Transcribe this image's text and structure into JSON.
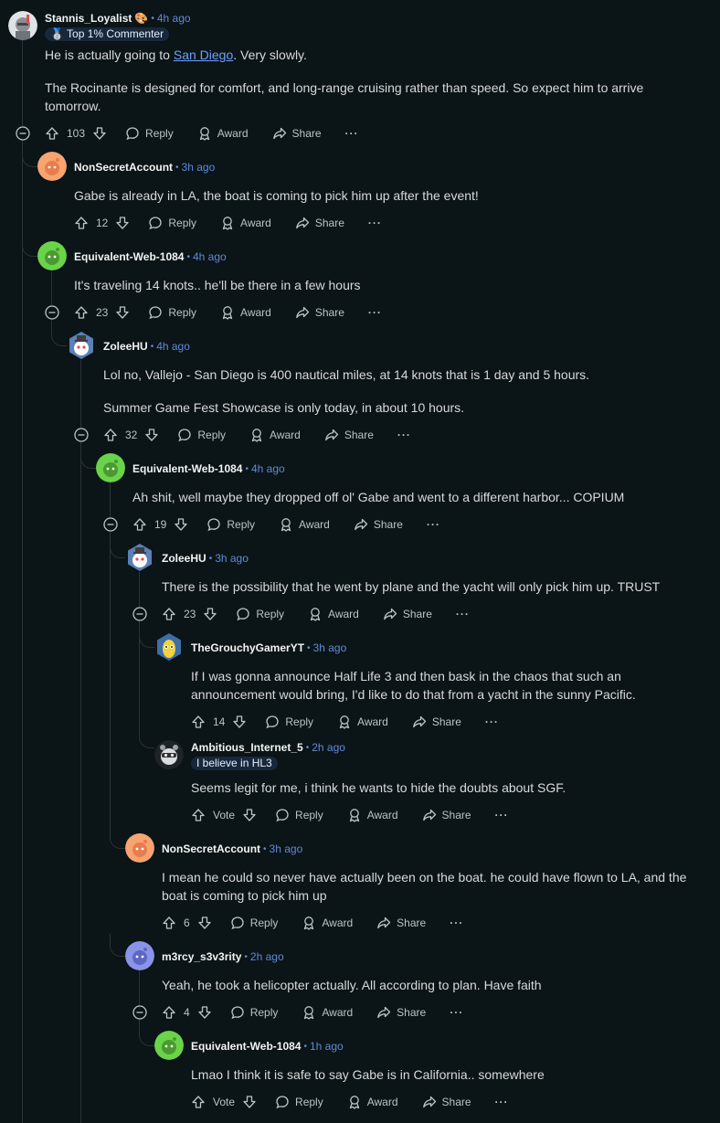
{
  "labels": {
    "reply": "Reply",
    "award": "Award",
    "share": "Share",
    "vote": "Vote",
    "more": "···"
  },
  "colors": {
    "background": "#0b1416",
    "username": "#f2f4f5",
    "time": "#5d8bd9",
    "link": "#6ea1ff",
    "thread_line": "#2a3236"
  },
  "comments": [
    {
      "user": "Stannis_Loyalist",
      "emoji": "🎨",
      "time": "4h ago",
      "flair": "🥈 Top 1% Commenter",
      "avatar": "avatar-knight",
      "body": [
        "He is actually going to ",
        "San Diego",
        ". Very slowly.",
        "The Rocinante is designed for comfort, and long-range cruising rather than speed. So expect him to arrive tomorrow."
      ],
      "votes": "103"
    },
    {
      "user": "NonSecretAccount",
      "time": "3h ago",
      "avatar": "avatar-orange",
      "body": [
        "Gabe is already in LA, the boat is coming to pick him up after the event!"
      ],
      "votes": "12"
    },
    {
      "user": "Equivalent-Web-1084",
      "time": "4h ago",
      "avatar": "avatar-green",
      "body": [
        "It's traveling 14 knots.. he'll be there in a few hours"
      ],
      "votes": "23"
    },
    {
      "user": "ZoleeHU",
      "time": "4h ago",
      "avatar": "avatar-snoo-hat",
      "body": [
        "Lol no, Vallejo - San Diego is 400 nautical miles, at 14 knots that is 1 day and 5 hours.",
        "Summer Game Fest Showcase is only today, in about 10 hours."
      ],
      "votes": "32"
    },
    {
      "user": "Equivalent-Web-1084",
      "time": "4h ago",
      "avatar": "avatar-green",
      "body": [
        "Ah shit, well maybe they dropped off ol' Gabe and went to a different harbor... COPIUM"
      ],
      "votes": "19"
    },
    {
      "user": "ZoleeHU",
      "time": "3h ago",
      "avatar": "avatar-snoo-hat",
      "body": [
        "There is the possibility that he went by plane and the yacht will only pick him up. TRUST"
      ],
      "votes": "23"
    },
    {
      "user": "TheGrouchyGamerYT",
      "time": "3h ago",
      "avatar": "avatar-banana",
      "body": [
        "If I was gonna announce Half Life 3 and then bask in the chaos that such an announcement would bring, I'd like to do that from a yacht in the sunny Pacific."
      ],
      "votes": "14"
    },
    {
      "user": "Ambitious_Internet_5",
      "time": "2h ago",
      "flair": "I believe in HL3",
      "avatar": "avatar-raccoon",
      "body": [
        "Seems legit for me, i think he wants to hide the doubts about SGF."
      ],
      "votes": "Vote"
    },
    {
      "user": "NonSecretAccount",
      "time": "3h ago",
      "avatar": "avatar-orange",
      "body": [
        "I mean he could so never have actually been on the boat. he could have flown to LA, and the boat is coming to pick him up"
      ],
      "votes": "6"
    },
    {
      "user": "m3rcy_s3v3rity",
      "time": "2h ago",
      "avatar": "avatar-purple",
      "body": [
        "Yeah, he took a helicopter actually. All according to plan. Have faith"
      ],
      "votes": "4"
    },
    {
      "user": "Equivalent-Web-1084",
      "time": "1h ago",
      "avatar": "avatar-green",
      "body": [
        "Lmao I think it is safe to say Gabe is in California.. somewhere"
      ],
      "votes": "Vote"
    }
  ]
}
